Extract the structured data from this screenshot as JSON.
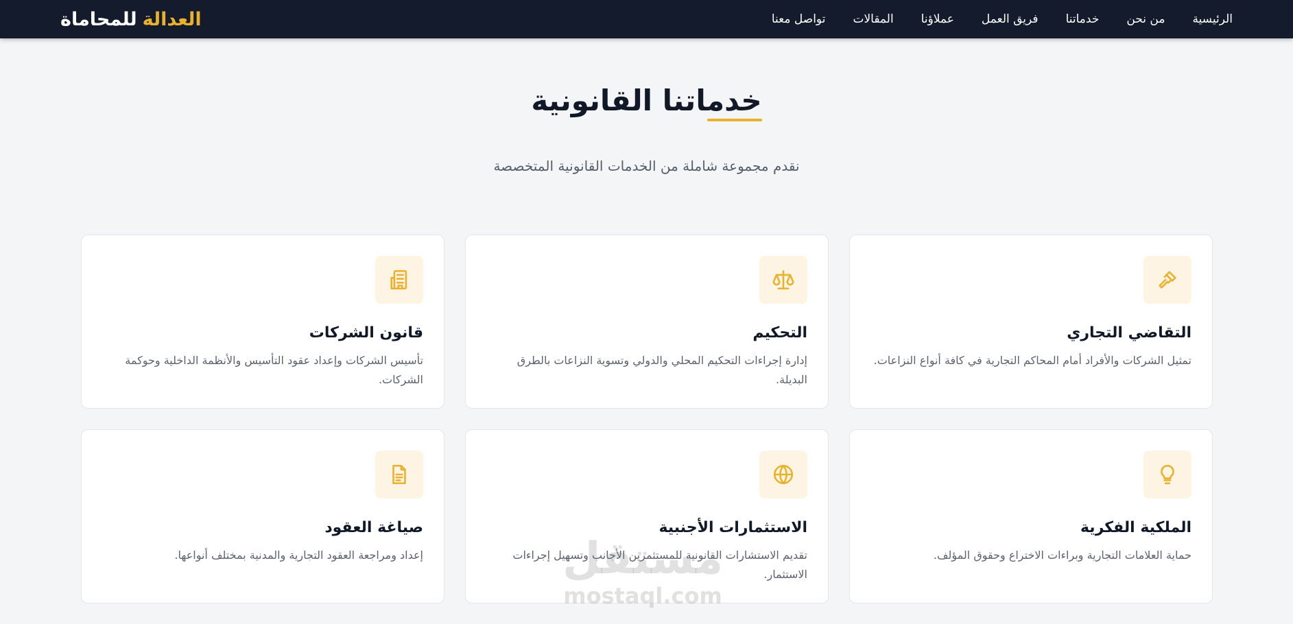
{
  "brand": {
    "accent": "العدالة",
    "rest": "للمحاماة"
  },
  "nav": {
    "items": [
      "الرئيسية",
      "من نحن",
      "خدماتنا",
      "فريق العمل",
      "عملاؤنا",
      "المقالات",
      "تواصل معنا"
    ]
  },
  "section": {
    "title": "خدماتنا القانونية",
    "subtitle": "نقدم مجموعة شاملة من الخدمات القانونية المتخصصة"
  },
  "services": [
    {
      "icon": "gavel-icon",
      "title": "التقاضي التجاري",
      "desc": "تمثيل الشركات والأفراد أمام المحاكم التجارية في كافة أنواع النزاعات."
    },
    {
      "icon": "scales-icon",
      "title": "التحكيم",
      "desc": "إدارة إجراءات التحكيم المحلي والدولي وتسوية النزاعات بالطرق البديلة."
    },
    {
      "icon": "building-icon",
      "title": "قانون الشركات",
      "desc": "تأسيس الشركات وإعداد عقود التأسيس والأنظمة الداخلية وحوكمة الشركات."
    },
    {
      "icon": "lightbulb-icon",
      "title": "الملكية الفكرية",
      "desc": "حماية العلامات التجارية وبراءات الاختراع وحقوق المؤلف."
    },
    {
      "icon": "globe-icon",
      "title": "الاستثمارات الأجنبية",
      "desc": "تقديم الاستشارات القانونية للمستثمرين الأجانب وتسهيل إجراءات الاستثمار."
    },
    {
      "icon": "document-icon",
      "title": "صياغة العقود",
      "desc": "إعداد ومراجعة العقود التجارية والمدنية بمختلف أنواعها."
    }
  ],
  "watermark": {
    "arabic": "مستقل",
    "latin": "mostaql.com"
  },
  "colors": {
    "navbar": "#141b2d",
    "accent": "#e9b12c",
    "icon_bg": "#fdf4e3",
    "page_bg": "#f4f5f7"
  }
}
